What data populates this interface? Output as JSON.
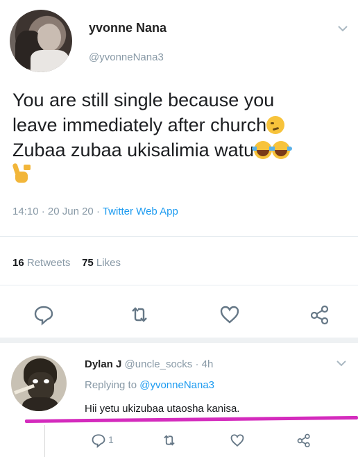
{
  "tweet": {
    "name": "yvonne Nana",
    "handle": "@yvonneNana3",
    "text_line1": "You are still single because you",
    "text_line2": "leave immediately after church",
    "text_line3": "Zubaa zubaa ukisalimia watu",
    "time": "14:10",
    "sep1": " · ",
    "date": "20 Jun 20",
    "sep2": " · ",
    "source": "Twitter Web App",
    "retweets_count": "16",
    "retweets_label": "Retweets",
    "likes_count": "75",
    "likes_label": "Likes"
  },
  "reply": {
    "name": "Dylan J",
    "handle": "@uncle_socks",
    "sep": " · ",
    "age": "4h",
    "replying_label": "Replying to",
    "replying_to": "@yvonneNana3",
    "text": "Hii yetu ukizubaa utaosha kanisa.",
    "reply_count": "1"
  },
  "icons": {
    "tweet_actions": [
      "reply-icon",
      "retweet-icon",
      "like-icon",
      "share-icon"
    ],
    "emojis": [
      "smirk-emoji",
      "laughing-tears-emoji",
      "victory-hand-emoji"
    ]
  },
  "colors": {
    "link_blue": "#1d9bf0",
    "muted_gray": "#8899a6",
    "highlight_underline": "#d42bbd"
  }
}
